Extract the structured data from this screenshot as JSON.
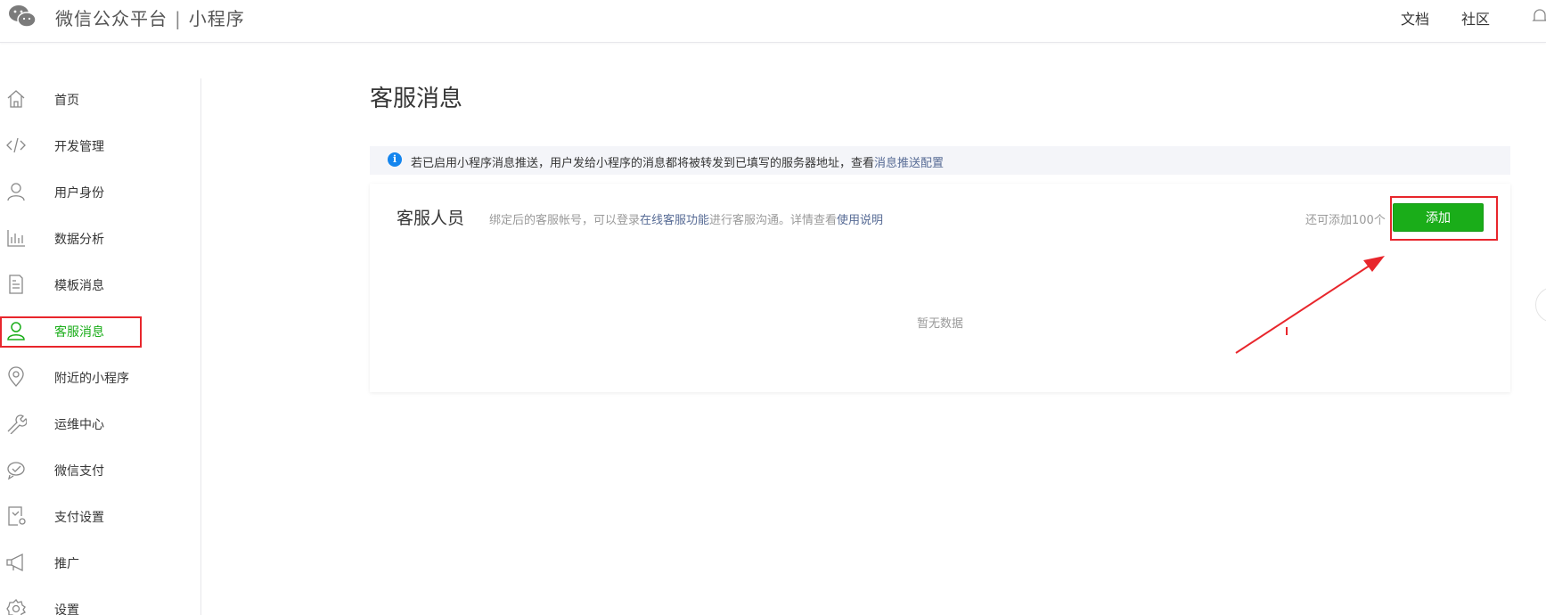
{
  "header": {
    "brand": "微信公众平台",
    "separator": "|",
    "product": "小程序",
    "links": [
      "文档",
      "社区"
    ]
  },
  "sidebar": {
    "items": [
      {
        "label": "首页",
        "icon": "home-icon",
        "active": false
      },
      {
        "label": "开发管理",
        "icon": "code-icon",
        "active": false
      },
      {
        "label": "用户身份",
        "icon": "user-icon",
        "active": false
      },
      {
        "label": "数据分析",
        "icon": "bar-chart-icon",
        "active": false
      },
      {
        "label": "模板消息",
        "icon": "document-icon",
        "active": false
      },
      {
        "label": "客服消息",
        "icon": "customer-service-icon",
        "active": true
      },
      {
        "label": "附近的小程序",
        "icon": "location-pin-icon",
        "active": false
      },
      {
        "label": "运维中心",
        "icon": "wrench-icon",
        "active": false
      },
      {
        "label": "微信支付",
        "icon": "wechat-pay-icon",
        "active": false
      },
      {
        "label": "支付设置",
        "icon": "payment-settings-icon",
        "active": false
      },
      {
        "label": "推广",
        "icon": "megaphone-icon",
        "active": false
      },
      {
        "label": "设置",
        "icon": "gear-icon",
        "active": false
      }
    ]
  },
  "main": {
    "title": "客服消息",
    "notice": {
      "text": "若已启用小程序消息推送，用户发给小程序的消息都将被转发到已填写的服务器地址，查看",
      "link": "消息推送配置"
    },
    "staff": {
      "title": "客服人员",
      "desc_prefix": "绑定后的客服帐号，可以登录",
      "desc_link1": "在线客服功能",
      "desc_middle": "进行客服沟通。详情查看",
      "desc_link2": "使用说明",
      "quota": "还可添加100个",
      "add_label": "添加",
      "empty": "暂无数据"
    }
  },
  "colors": {
    "accent": "#1aad19",
    "link": "#576b95",
    "info": "#1485ee",
    "annotation": "#e8262c"
  }
}
